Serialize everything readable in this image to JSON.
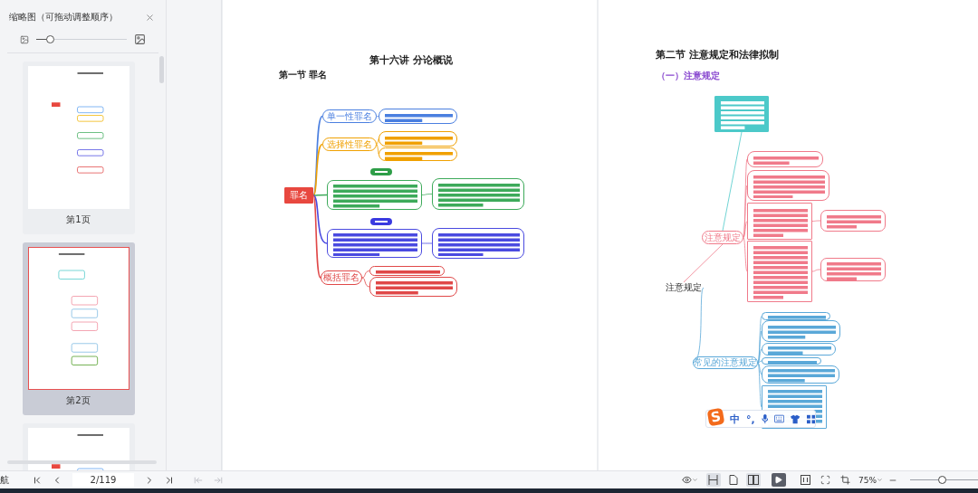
{
  "sidebar": {
    "title": "缩略图（可拖动调整顺序）",
    "size_slider": {
      "level": 0.15
    },
    "thumbnails": [
      {
        "label": "第1页",
        "selected": false
      },
      {
        "label": "第2页",
        "selected": true
      },
      {
        "selected": false
      }
    ]
  },
  "pages": [
    {
      "title": "第十六讲 分论概说",
      "section": "第一节 罪名",
      "nodes": [
        {
          "kind": "root",
          "text": "罪名",
          "color": "#e8483f"
        },
        {
          "kind": "branch",
          "text": "单一性罪名",
          "color": "#4a7fe0"
        },
        {
          "kind": "leaf",
          "color": "#4a7fe0"
        },
        {
          "kind": "branch",
          "text": "选择性罪名",
          "color": "#f0a000"
        },
        {
          "kind": "leaf",
          "color": "#f0a000"
        },
        {
          "kind": "leaf",
          "color": "#f0a000"
        },
        {
          "kind": "tag",
          "color": "#2e9e48"
        },
        {
          "kind": "octagon",
          "color": "#3daa5a"
        },
        {
          "kind": "leaf",
          "color": "#3daa5a"
        },
        {
          "kind": "tag",
          "color": "#3a3ae0"
        },
        {
          "kind": "octagon",
          "color": "#4a4ae0"
        },
        {
          "kind": "leaf",
          "color": "#4a4ae0"
        },
        {
          "kind": "branch",
          "text": "概括罪名",
          "color": "#e04848"
        },
        {
          "kind": "leaf",
          "color": "#e04848"
        },
        {
          "kind": "leaf",
          "color": "#e04848"
        }
      ]
    },
    {
      "title": "第二节 注意规定和法律拟制",
      "section": "（一）注意规定",
      "nodes": [
        {
          "kind": "plain",
          "text": "注意规定"
        },
        {
          "kind": "filled",
          "color": "#4cc9c9"
        },
        {
          "kind": "branch",
          "text": "注意规定",
          "color": "#f07a8a"
        },
        {
          "kind": "leaf",
          "color": "#f07a8a"
        },
        {
          "kind": "leaf",
          "color": "#f07a8a"
        },
        {
          "kind": "rect",
          "color": "#f07a8a"
        },
        {
          "kind": "octagon",
          "color": "#f07a8a"
        },
        {
          "kind": "rect",
          "color": "#f07a8a"
        },
        {
          "kind": "octagon",
          "color": "#f07a8a"
        },
        {
          "kind": "branch",
          "text": "常见的注意规定",
          "color": "#5aa8d8"
        },
        {
          "kind": "leaf",
          "color": "#5aa8d8"
        },
        {
          "kind": "leaf",
          "color": "#5aa8d8"
        },
        {
          "kind": "leaf",
          "color": "#5aa8d8"
        },
        {
          "kind": "leaf",
          "color": "#5aa8d8"
        },
        {
          "kind": "leaf",
          "color": "#5aa8d8"
        },
        {
          "kind": "rect",
          "color": "#5aa8d8"
        }
      ]
    }
  ],
  "ime_toolbar": {
    "logo": "S",
    "mode": "中",
    "punctuation": "°,"
  },
  "status_bar": {
    "nav_label": "航",
    "page_field": "2/119",
    "view_buttons": [
      {
        "kind": "fit-width",
        "selected": true
      },
      {
        "kind": "single",
        "selected": false
      },
      {
        "kind": "double",
        "selected": true
      }
    ],
    "zoom": "75%",
    "zoom_slider": {
      "level": 0.47
    }
  }
}
